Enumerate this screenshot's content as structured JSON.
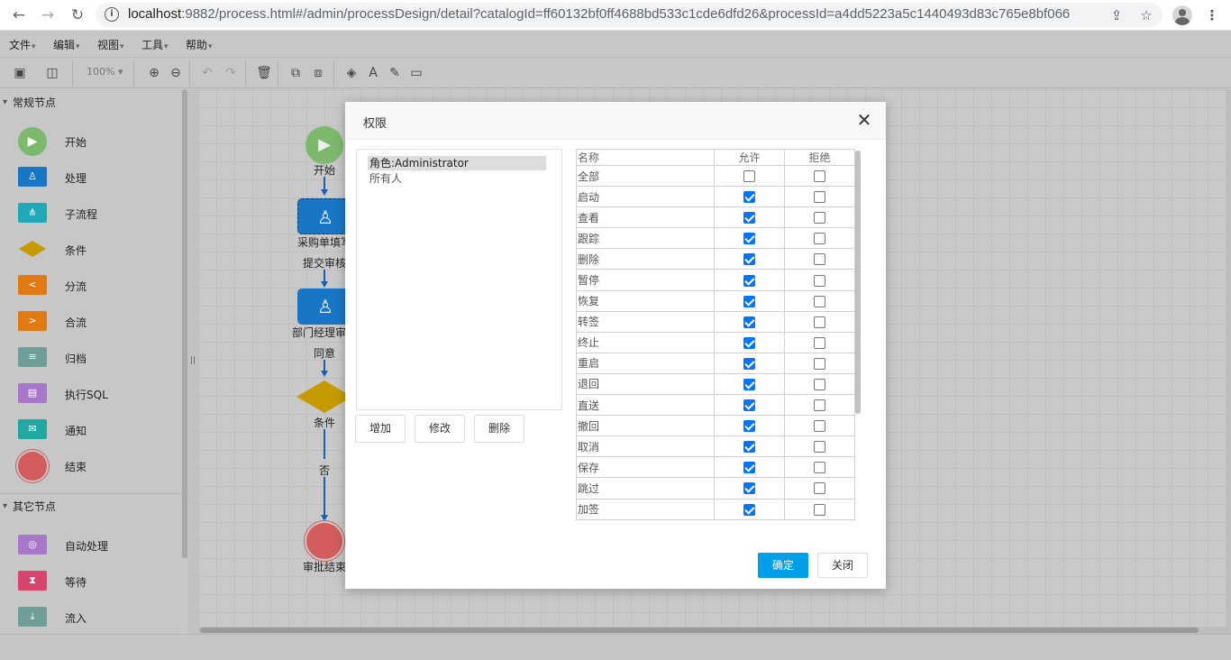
{
  "browser": {
    "url_host": "localhost",
    "url_rest": ":9882/process.html#/admin/processDesign/detail?catalogId=ff60132bf0ff4688bd533c1cde6dfd26&processId=a4dd5223a5c1440493d83c765e8bf066"
  },
  "menu": [
    "文件",
    "编辑",
    "视图",
    "工具",
    "帮助"
  ],
  "toolbar": {
    "zoom": "100%"
  },
  "left_panel": {
    "section_common": "常规节点",
    "common_nodes": [
      {
        "label": "开始",
        "color": "#7cb96d"
      },
      {
        "label": "处理",
        "color": "#1976c6"
      },
      {
        "label": "子流程",
        "color": "#1fa9b7"
      },
      {
        "label": "条件",
        "color": "#c59b00"
      },
      {
        "label": "分流",
        "color": "#e07a12"
      },
      {
        "label": "合流",
        "color": "#e07a12"
      },
      {
        "label": "归档",
        "color": "#6f9e98"
      },
      {
        "label": "执行SQL",
        "color": "#a977c9"
      },
      {
        "label": "通知",
        "color": "#1fa9a0"
      },
      {
        "label": "结束",
        "color": "#d35d5d"
      }
    ],
    "section_other": "其它节点",
    "other_nodes": [
      {
        "label": "自动处理",
        "color": "#a977c9"
      },
      {
        "label": "等待",
        "color": "#d8446e"
      },
      {
        "label": "流入",
        "color": "#6f9e98"
      }
    ]
  },
  "flow": {
    "start": "开始",
    "task1": "采购单填写",
    "edge1": "提交审核",
    "task2": "部门经理审批",
    "edge2": "同意",
    "cond": "条件",
    "edge3": "否",
    "end": "审批结束"
  },
  "dialog": {
    "title": "权限",
    "roles": [
      "角色:Administrator",
      "所有人"
    ],
    "buttons": {
      "add": "增加",
      "edit": "修改",
      "delete": "删除"
    },
    "table_headers": {
      "name": "名称",
      "allow": "允许",
      "deny": "拒绝"
    },
    "permissions": [
      {
        "name": "全部",
        "allow": false,
        "deny": false
      },
      {
        "name": "启动",
        "allow": true,
        "deny": false
      },
      {
        "name": "查看",
        "allow": true,
        "deny": false
      },
      {
        "name": "跟踪",
        "allow": true,
        "deny": false
      },
      {
        "name": "删除",
        "allow": true,
        "deny": false
      },
      {
        "name": "暂停",
        "allow": true,
        "deny": false
      },
      {
        "name": "恢复",
        "allow": true,
        "deny": false
      },
      {
        "name": "转签",
        "allow": true,
        "deny": false
      },
      {
        "name": "终止",
        "allow": true,
        "deny": false
      },
      {
        "name": "重启",
        "allow": true,
        "deny": false
      },
      {
        "name": "退回",
        "allow": true,
        "deny": false
      },
      {
        "name": "直送",
        "allow": true,
        "deny": false
      },
      {
        "name": "撤回",
        "allow": true,
        "deny": false
      },
      {
        "name": "取消",
        "allow": true,
        "deny": false
      },
      {
        "name": "保存",
        "allow": true,
        "deny": false
      },
      {
        "name": "跳过",
        "allow": true,
        "deny": false
      },
      {
        "name": "加签",
        "allow": true,
        "deny": false
      }
    ],
    "ok": "确定",
    "close": "关闭"
  }
}
